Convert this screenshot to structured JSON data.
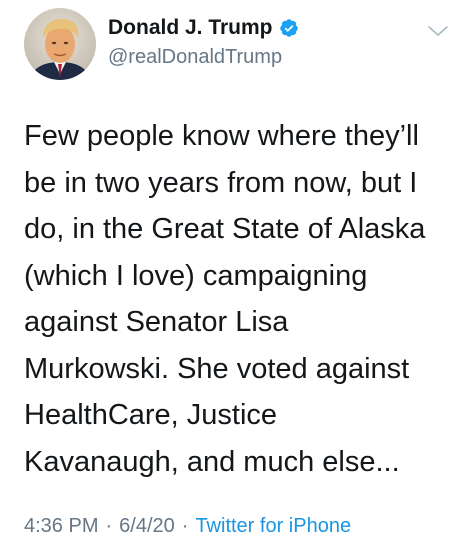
{
  "tweet": {
    "author": {
      "display_name": "Donald J. Trump",
      "handle": "@realDonaldTrump",
      "verified": true,
      "avatar_icon": "profile-photo"
    },
    "menu_icon": "chevron-down-icon",
    "text": "Few people know where they’ll\nbe in two years from now, but I\ndo, in the Great State of Alaska\n(which I love) campaigning\nagainst Senator Lisa\nMurkowski. She voted against\nHealthCare, Justice\nKavanaugh, and much else...",
    "time": "4:36 PM",
    "separator": "·",
    "date": "6/4/20",
    "source": "Twitter for iPhone"
  },
  "colors": {
    "text": "#14171a",
    "secondary": "#657786",
    "link": "#1b95e0",
    "verified": "#1da1f2"
  }
}
